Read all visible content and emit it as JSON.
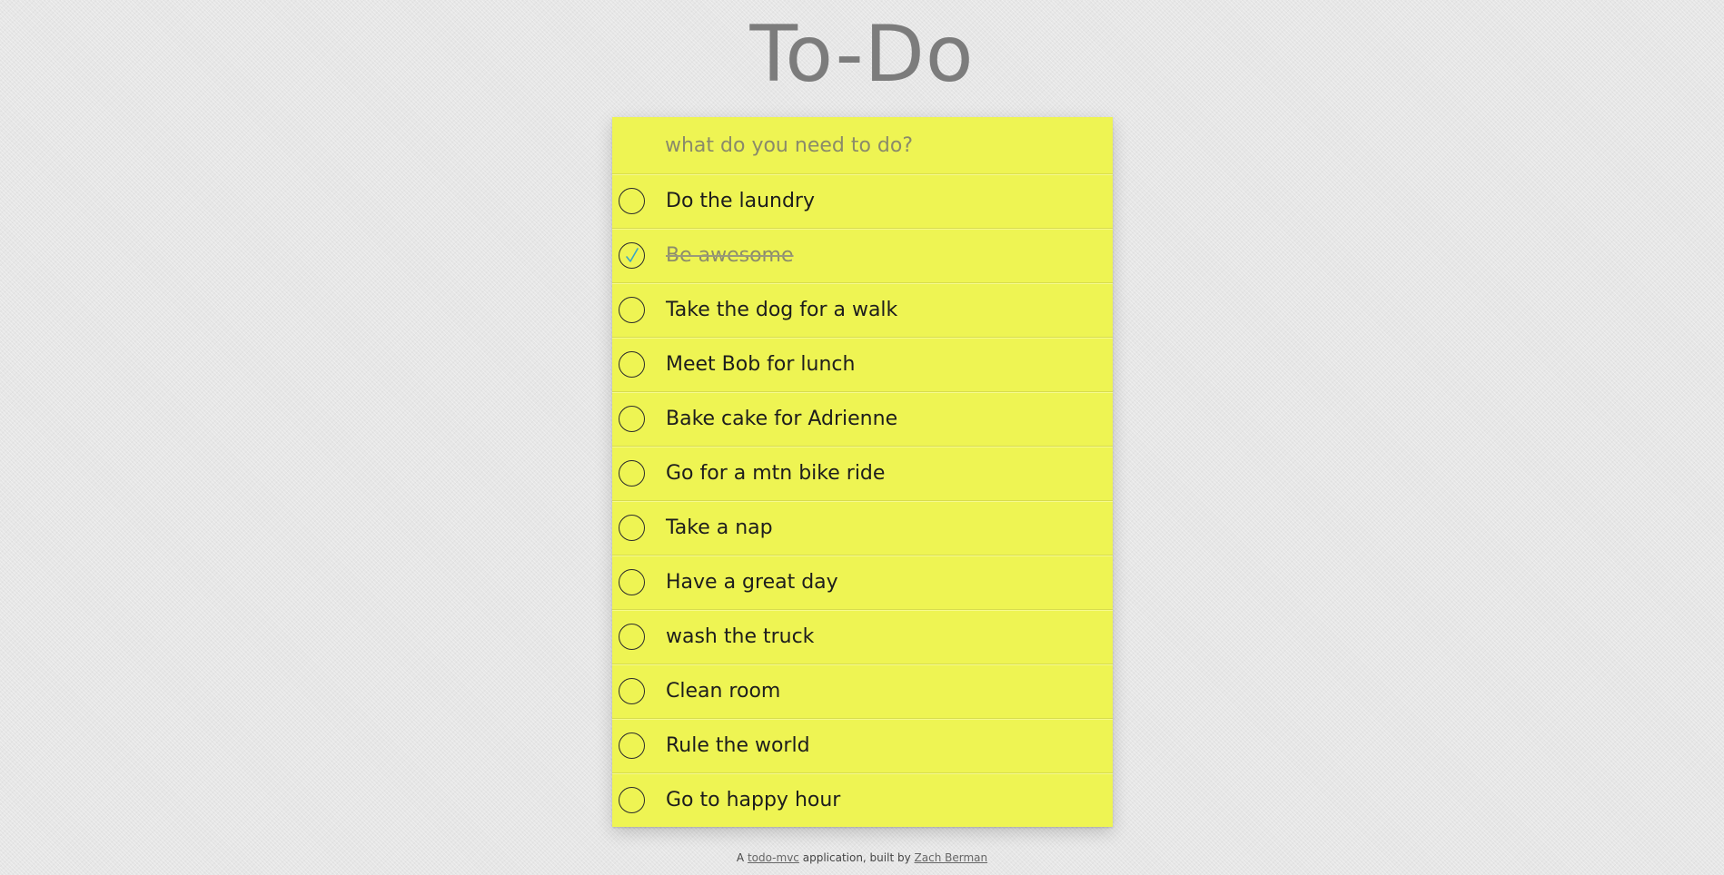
{
  "header": {
    "title": "To-Do"
  },
  "new_todo": {
    "placeholder": "what do you need to do?"
  },
  "todos": [
    {
      "label": "Do the laundry",
      "completed": false
    },
    {
      "label": "Be awesome",
      "completed": true
    },
    {
      "label": "Take the dog for a walk",
      "completed": false
    },
    {
      "label": "Meet Bob for lunch",
      "completed": false
    },
    {
      "label": "Bake cake for Adrienne",
      "completed": false
    },
    {
      "label": "Go for a mtn bike ride",
      "completed": false
    },
    {
      "label": "Take a nap",
      "completed": false
    },
    {
      "label": "Have a great day",
      "completed": false
    },
    {
      "label": "wash the truck",
      "completed": false
    },
    {
      "label": "Clean room",
      "completed": false
    },
    {
      "label": "Rule the world",
      "completed": false
    },
    {
      "label": "Go to happy hour",
      "completed": false
    }
  ],
  "footer": {
    "prefix": "A",
    "link1": "todo-mvc",
    "middle": "application, built by",
    "link2": "Zach Berman"
  },
  "colors": {
    "note_background": "#eef453",
    "title": "#7c7c7c",
    "check_mark": "#3aa6c4"
  },
  "icons": {
    "toggle": "circle-checkbox-icon",
    "check": "check-mark-icon"
  }
}
